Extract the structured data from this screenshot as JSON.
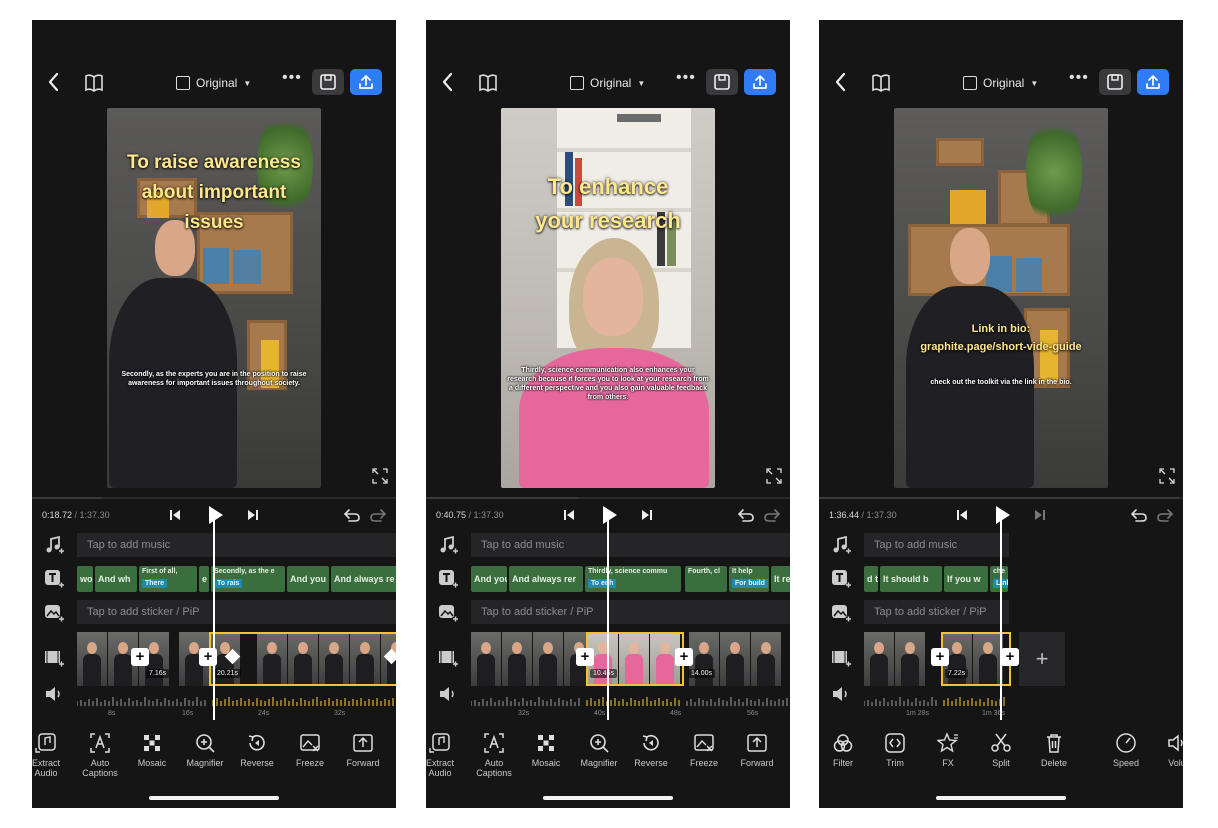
{
  "screens": [
    {
      "topbar": {
        "aspect_label": "Original"
      },
      "video": {
        "big_caption_lines": [
          "To raise awareness",
          "about important",
          "issues"
        ],
        "sub_caption": "Secondly, as the experts you are in the position to raise awareness for important issues throughout society."
      },
      "transport": {
        "current_time": "0:18.72",
        "total_time": "/ 1:37.30"
      },
      "tracks": {
        "music_placeholder": "Tap to add music",
        "sticker_placeholder": "Tap to add sticker / PiP",
        "text_clips": [
          {
            "title": "wo",
            "sub": ""
          },
          {
            "title": "And wh",
            "sub": ""
          },
          {
            "title": "First of all,",
            "sub": "There"
          },
          {
            "title": "e",
            "sub": ""
          },
          {
            "title": "Secondly, as the e",
            "sub": "To rais"
          },
          {
            "title": "And you",
            "sub": ""
          },
          {
            "title": "And always re",
            "sub": ""
          }
        ],
        "segment_durations": [
          "7.16s",
          "20.21s"
        ],
        "ruler": [
          "8s",
          "16s",
          "24s",
          "32s"
        ]
      },
      "toolbar": [
        {
          "icon": "extract-audio-icon",
          "label": "Extract Audio"
        },
        {
          "icon": "auto-captions-icon",
          "label": "Auto Captions"
        },
        {
          "icon": "mosaic-icon",
          "label": "Mosaic"
        },
        {
          "icon": "magnifier-icon",
          "label": "Magnifier"
        },
        {
          "icon": "reverse-icon",
          "label": "Reverse"
        },
        {
          "icon": "freeze-icon",
          "label": "Freeze"
        },
        {
          "icon": "forward-icon",
          "label": "Forward"
        }
      ]
    },
    {
      "topbar": {
        "aspect_label": "Original"
      },
      "video": {
        "big_caption_lines": [
          "To enhance",
          "your research"
        ],
        "sub_caption": "Thirdly, science communication also enhances your research because it forces you to look at your research from a different perspective and you also gain valuable feedback from others."
      },
      "transport": {
        "current_time": "0:40.75",
        "total_time": "/ 1:37.30"
      },
      "tracks": {
        "music_placeholder": "Tap to add music",
        "sticker_placeholder": "Tap to add sticker / PiP",
        "text_clips": [
          {
            "title": "And you",
            "sub": ""
          },
          {
            "title": "And always rer",
            "sub": ""
          },
          {
            "title": "Thirdly, science commu",
            "sub": "To enh"
          },
          {
            "title": "Fourth, cl",
            "sub": ""
          },
          {
            "title": "It help",
            "sub": "For build"
          },
          {
            "title": "It re",
            "sub": ""
          }
        ],
        "segment_durations": [
          "10.46s",
          "14.00s"
        ],
        "ruler": [
          "32s",
          "40s",
          "48s",
          "56s"
        ]
      },
      "toolbar": [
        {
          "icon": "extract-audio-icon",
          "label": "Extract Audio"
        },
        {
          "icon": "auto-captions-icon",
          "label": "Auto Captions"
        },
        {
          "icon": "mosaic-icon",
          "label": "Mosaic"
        },
        {
          "icon": "magnifier-icon",
          "label": "Magnifier"
        },
        {
          "icon": "reverse-icon",
          "label": "Reverse"
        },
        {
          "icon": "freeze-icon",
          "label": "Freeze"
        },
        {
          "icon": "forward-icon",
          "label": "Forward"
        }
      ]
    },
    {
      "topbar": {
        "aspect_label": "Original"
      },
      "video": {
        "big_caption_lines": [
          "Link in bio:",
          "graphite.page/short-vide-guide"
        ],
        "sub_caption": "check out the toolkit via the link in the bio."
      },
      "transport": {
        "current_time": "1:36.44",
        "total_time": "/ 1:37.30"
      },
      "tracks": {
        "music_placeholder": "Tap to add music",
        "sticker_placeholder": "Tap to add sticker / PiP",
        "text_clips": [
          {
            "title": "d ti",
            "sub": ""
          },
          {
            "title": "It should b",
            "sub": ""
          },
          {
            "title": "If you w",
            "sub": ""
          },
          {
            "title": "che",
            "sub": "Link"
          }
        ],
        "segment_durations": [
          "7.22s"
        ],
        "ruler": [
          "1m 28s",
          "1m 36s"
        ]
      },
      "toolbar": [
        {
          "icon": "filter-icon",
          "label": "Filter"
        },
        {
          "icon": "trim-icon",
          "label": "Trim"
        },
        {
          "icon": "fx-icon",
          "label": "FX"
        },
        {
          "icon": "split-icon",
          "label": "Split"
        },
        {
          "icon": "delete-icon",
          "label": "Delete"
        },
        {
          "icon": "speed-icon",
          "label": "Speed"
        },
        {
          "icon": "volume-icon",
          "label": "Volu"
        }
      ]
    }
  ],
  "colors": {
    "accent_blue": "#2f7cf6",
    "selection_yellow": "#f2c230",
    "text_clip_green": "#3b6e3e",
    "caption_yellow": "#ffe78c"
  }
}
